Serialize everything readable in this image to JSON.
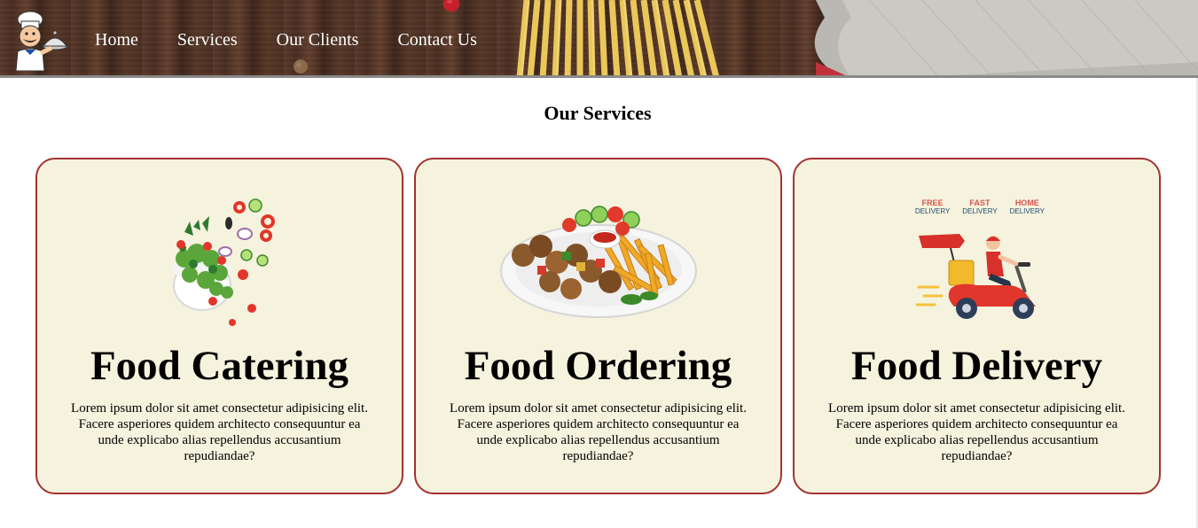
{
  "header": {
    "nav": [
      "Home",
      "Services",
      "Our Clients",
      "Contact Us"
    ]
  },
  "services": {
    "title": "Our Services",
    "cards": [
      {
        "title": "Food Catering",
        "text": "Lorem ipsum dolor sit amet consectetur adipisicing elit. Facere asperiores quidem architecto consequuntur ea unde explicabo alias repellendus accusantium repudiandae?",
        "image": "salad"
      },
      {
        "title": "Food Ordering",
        "text": "Lorem ipsum dolor sit amet consectetur adipisicing elit. Facere asperiores quidem architecto consequuntur ea unde explicabo alias repellendus accusantium repudiandae?",
        "image": "kebab-plate"
      },
      {
        "title": "Food Delivery",
        "text": "Lorem ipsum dolor sit amet consectetur adipisicing elit. Facere asperiores quidem architecto consequuntur ea unde explicabo alias repellendus accusantium repudiandae?",
        "image": "scooter-delivery",
        "badges": [
          {
            "top": "FREE",
            "bottom": "DELIVERY"
          },
          {
            "top": "FAST",
            "bottom": "DELIVERY"
          },
          {
            "top": "HOME",
            "bottom": "DELIVERY"
          }
        ]
      }
    ]
  },
  "colors": {
    "card_bg": "#f5f3de",
    "card_border": "#a3322f",
    "nav_text": "#ffffff"
  }
}
